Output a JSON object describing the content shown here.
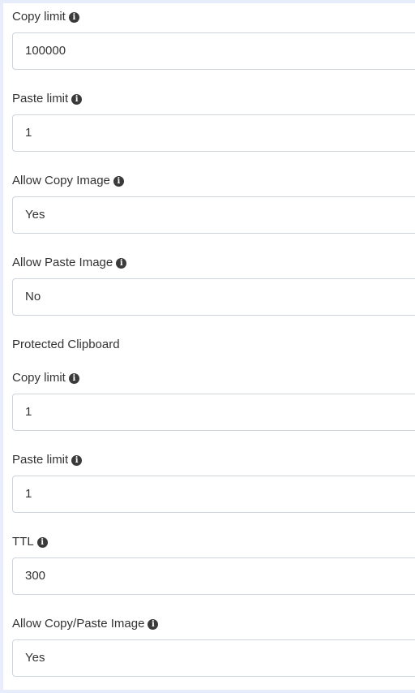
{
  "fields": [
    {
      "label": "Copy limit",
      "value": "100000"
    },
    {
      "label": "Paste limit",
      "value": "1"
    },
    {
      "label": "Allow Copy Image",
      "value": "Yes"
    },
    {
      "label": "Allow Paste Image",
      "value": "No"
    }
  ],
  "protected": {
    "heading": "Protected Clipboard",
    "fields": [
      {
        "label": "Copy limit",
        "value": "1"
      },
      {
        "label": "Paste limit",
        "value": "1"
      },
      {
        "label": "TTL",
        "value": "300"
      },
      {
        "label": "Allow Copy/Paste Image",
        "value": "Yes"
      }
    ]
  },
  "icons": {
    "info": "info-icon"
  }
}
